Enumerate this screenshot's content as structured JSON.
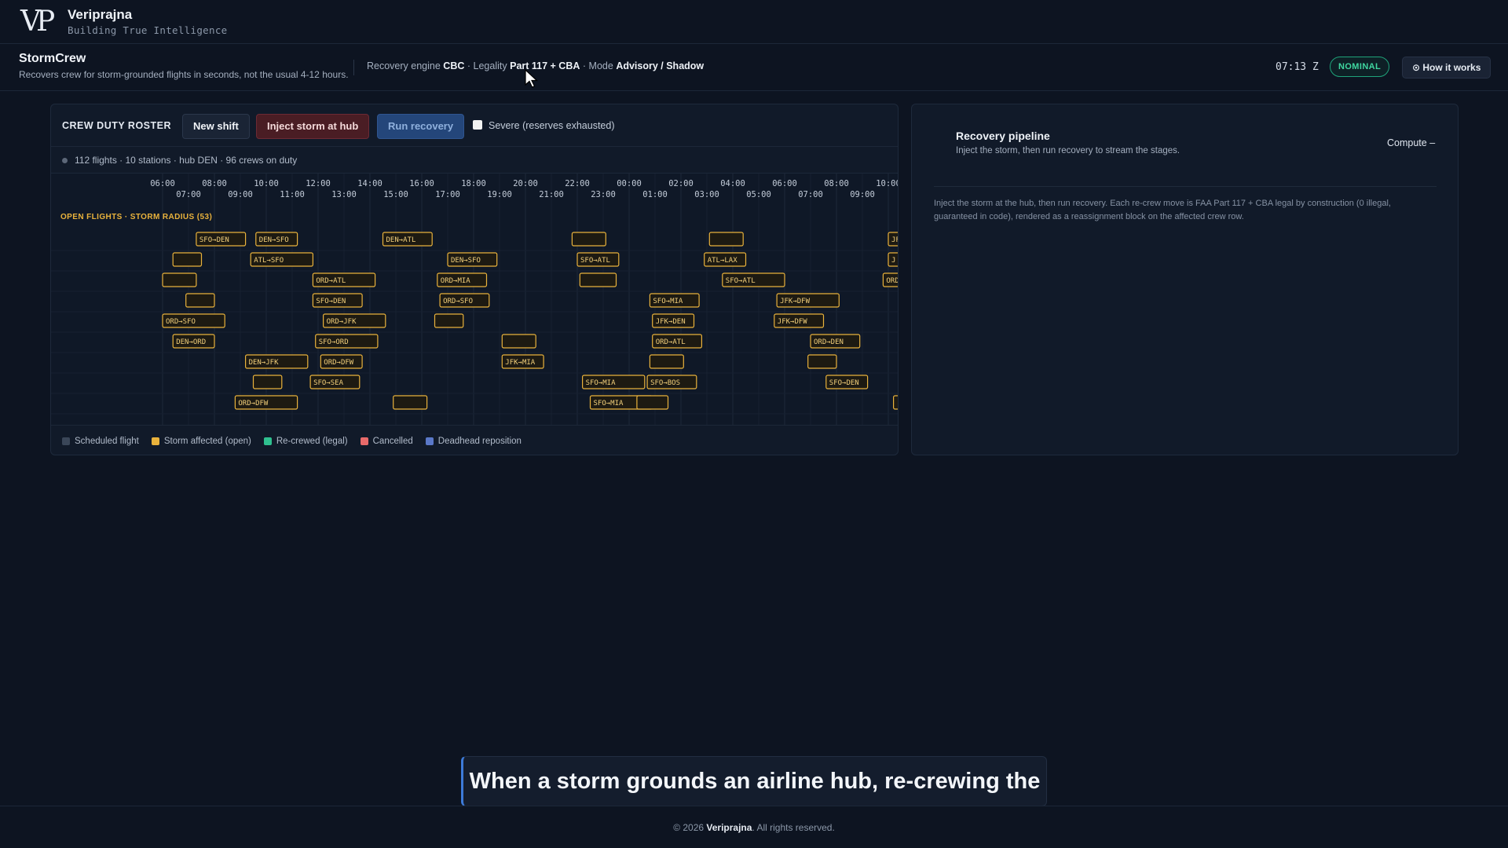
{
  "brand": {
    "logo": "VP",
    "name": "Veriprajna",
    "tagline": "Building True Intelligence"
  },
  "header": {
    "title": "StormCrew",
    "subtitle": "Recovers crew for storm-grounded flights in seconds, not the usual 4-12 hours.",
    "meta": {
      "engine_label": "Recovery engine",
      "engine_value": "CBC",
      "legality_label": "Legality",
      "legality_value": "Part 117 + CBA",
      "mode_label": "Mode",
      "mode_value": "Advisory / Shadow",
      "sep": "·"
    },
    "clock": "07:13 Z",
    "status": "NOMINAL",
    "status_color": "#3fd6a0",
    "how_button": "⊙ How it works"
  },
  "roster": {
    "title": "CREW DUTY ROSTER",
    "new_shift": "New shift",
    "inject_storm": "Inject storm at hub",
    "run_recovery": "Run recovery",
    "severe_label": "Severe (reserves exhausted)",
    "severe_checked": false,
    "stats": "112 flights · 10 stations · hub DEN · 96 crews on duty",
    "legend": [
      {
        "label": "Scheduled flight",
        "color": "#3a4658"
      },
      {
        "label": "Storm affected (open)",
        "color": "#e9b23c"
      },
      {
        "label": "Re-crewed (legal)",
        "color": "#2fc08f"
      },
      {
        "label": "Cancelled",
        "color": "#e86a6a"
      },
      {
        "label": "Deadhead reposition",
        "color": "#5a78c8"
      }
    ]
  },
  "chart_data": {
    "type": "table",
    "open_label": "OPEN FLIGHTS · STORM RADIUS (53)",
    "time_axis_top": [
      "06:00",
      "08:00",
      "10:00",
      "12:00",
      "14:00",
      "16:00",
      "18:00",
      "20:00",
      "22:00",
      "00:00",
      "02:00",
      "04:00",
      "06:00",
      "08:00",
      "10:00"
    ],
    "time_axis_bottom": [
      "07:00",
      "09:00",
      "11:00",
      "13:00",
      "15:00",
      "17:00",
      "19:00",
      "21:00",
      "23:00",
      "01:00",
      "03:00",
      "05:00",
      "07:00",
      "09:00"
    ],
    "rows": [
      [
        {
          "s": 7.3,
          "e": 9.2,
          "l": "SFO→DEN"
        },
        {
          "s": 9.6,
          "e": 11.2,
          "l": "DEN→SFO"
        },
        {
          "s": 14.5,
          "e": 16.4,
          "l": "DEN→ATL"
        },
        {
          "s": 21.8,
          "e": 23.1,
          "l": ""
        },
        {
          "s": 27.1,
          "e": 28.4,
          "l": ""
        },
        {
          "s": 34.0,
          "e": 34.5,
          "l": "JF"
        }
      ],
      [
        {
          "s": 6.4,
          "e": 7.5,
          "l": ""
        },
        {
          "s": 9.4,
          "e": 11.8,
          "l": "ATL→SFO"
        },
        {
          "s": 17.0,
          "e": 18.9,
          "l": "DEN→SFO"
        },
        {
          "s": 22.0,
          "e": 23.6,
          "l": "SFO→ATL"
        },
        {
          "s": 26.9,
          "e": 28.5,
          "l": "ATL→LAX"
        },
        {
          "s": 34.0,
          "e": 34.5,
          "l": "J"
        }
      ],
      [
        {
          "s": 6.0,
          "e": 7.3,
          "l": ""
        },
        {
          "s": 11.8,
          "e": 14.2,
          "l": "ORD→ATL"
        },
        {
          "s": 16.6,
          "e": 18.5,
          "l": "ORD→MIA"
        },
        {
          "s": 22.1,
          "e": 23.5,
          "l": ""
        },
        {
          "s": 27.6,
          "e": 30.0,
          "l": "SFO→ATL"
        },
        {
          "s": 33.8,
          "e": 34.5,
          "l": "ORD"
        }
      ],
      [
        {
          "s": 6.9,
          "e": 8.0,
          "l": ""
        },
        {
          "s": 11.8,
          "e": 13.7,
          "l": "SFO→DEN"
        },
        {
          "s": 16.7,
          "e": 18.6,
          "l": "ORD→SFO"
        },
        {
          "s": 24.8,
          "e": 26.7,
          "l": "SFO→MIA"
        },
        {
          "s": 29.7,
          "e": 32.1,
          "l": "JFK→DFW"
        }
      ],
      [
        {
          "s": 6.0,
          "e": 8.4,
          "l": "ORD→SFO"
        },
        {
          "s": 12.2,
          "e": 14.6,
          "l": "ORD→JFK"
        },
        {
          "s": 16.5,
          "e": 17.6,
          "l": ""
        },
        {
          "s": 24.9,
          "e": 26.5,
          "l": "JFK→DEN"
        },
        {
          "s": 29.6,
          "e": 31.5,
          "l": "JFK→DFW"
        }
      ],
      [
        {
          "s": 6.4,
          "e": 8.0,
          "l": "DEN→ORD"
        },
        {
          "s": 11.9,
          "e": 14.3,
          "l": "SFO→ORD"
        },
        {
          "s": 19.1,
          "e": 20.4,
          "l": ""
        },
        {
          "s": 24.9,
          "e": 26.8,
          "l": "ORD→ATL"
        },
        {
          "s": 31.0,
          "e": 32.9,
          "l": "ORD→DEN"
        }
      ],
      [
        {
          "s": 9.2,
          "e": 11.6,
          "l": "DEN→JFK"
        },
        {
          "s": 12.1,
          "e": 13.7,
          "l": "ORD→DFW"
        },
        {
          "s": 19.1,
          "e": 20.7,
          "l": "JFK→MIA"
        },
        {
          "s": 24.8,
          "e": 26.1,
          "l": ""
        },
        {
          "s": 30.9,
          "e": 32.0,
          "l": ""
        }
      ],
      [
        {
          "s": 9.5,
          "e": 10.6,
          "l": ""
        },
        {
          "s": 11.7,
          "e": 13.6,
          "l": "SFO→SEA"
        },
        {
          "s": 22.2,
          "e": 24.6,
          "l": "SFO→MIA"
        },
        {
          "s": 24.7,
          "e": 26.6,
          "l": "SFO→BOS"
        },
        {
          "s": 31.6,
          "e": 33.2,
          "l": "SFO→DEN"
        }
      ],
      [
        {
          "s": 8.8,
          "e": 11.2,
          "l": "ORD→DFW"
        },
        {
          "s": 14.9,
          "e": 16.2,
          "l": ""
        },
        {
          "s": 22.5,
          "e": 24.9,
          "l": "SFO→MIA"
        },
        {
          "s": 24.3,
          "e": 25.5,
          "l": ""
        },
        {
          "s": 34.2,
          "e": 34.5,
          "l": ""
        }
      ]
    ]
  },
  "pipeline": {
    "title": "Recovery pipeline",
    "subtitle": "Inject the storm, then run recovery to stream the stages.",
    "compute": "Compute –",
    "description": "Inject the storm at the hub, then run recovery. Each re-crew move is FAA Part 117 + CBA legal by construction (0 illegal, guaranteed in code), rendered as a reassignment block on the affected crew row."
  },
  "caption": "When a storm grounds an airline hub, re-crewing the",
  "footer": {
    "prefix": "© 2026",
    "brand": "Veriprajna",
    "suffix": ". All rights reserved."
  }
}
